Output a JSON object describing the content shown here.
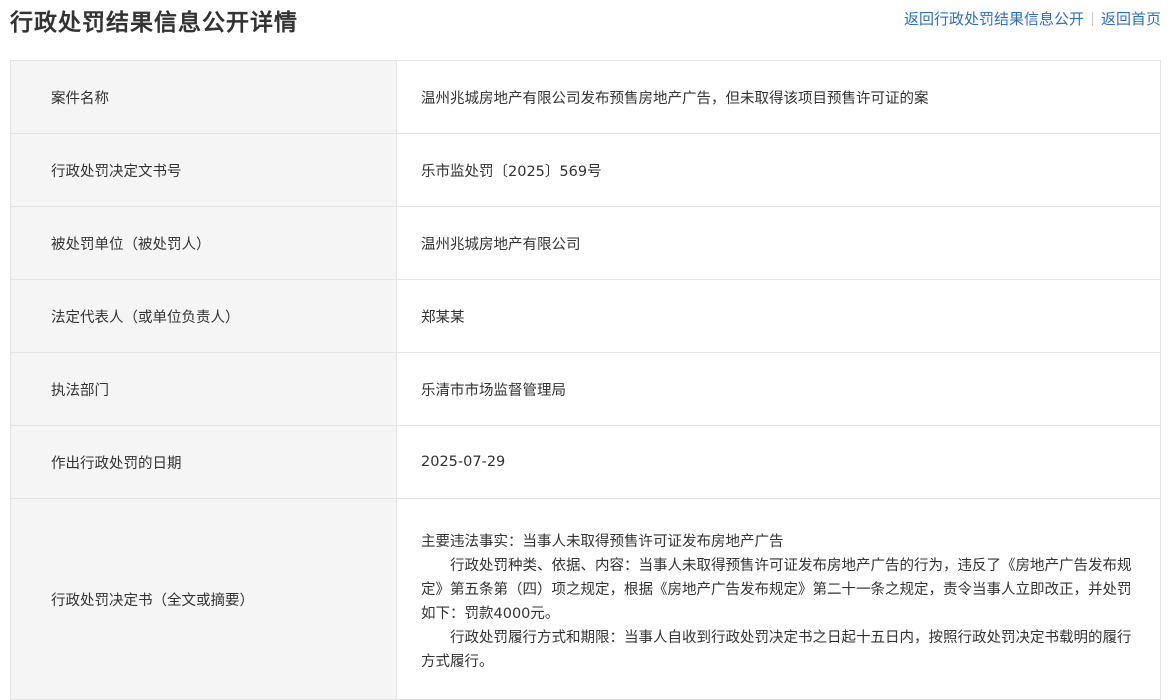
{
  "header": {
    "title": "行政处罚结果信息公开详情",
    "links": {
      "back_list": "返回行政处罚结果信息公开",
      "back_home": "返回首页"
    }
  },
  "rows": [
    {
      "label": "案件名称",
      "value": "温州兆城房地产有限公司发布预售房地产广告，但未取得该项目预售许可证的案"
    },
    {
      "label": "行政处罚决定文书号",
      "value": "乐市监处罚〔2025〕569号"
    },
    {
      "label": "被处罚单位（被处罚人）",
      "value": "温州兆城房地产有限公司"
    },
    {
      "label": "法定代表人（或单位负责人）",
      "value": "郑某某"
    },
    {
      "label": "执法部门",
      "value": "乐清市市场监督管理局"
    },
    {
      "label": "作出行政处罚的日期",
      "value": "2025-07-29"
    }
  ],
  "decision": {
    "label": "行政处罚决定书（全文或摘要）",
    "paragraphs": [
      "主要违法事实：当事人未取得预售许可证发布房地产广告",
      "行政处罚种类、依据、内容：当事人未取得预售许可证发布房地产广告的行为，违反了《房地产广告发布规定》第五条第（四）项之规定，根据《房地产广告发布规定》第二十一条之规定，责令当事人立即改正，并处罚如下：罚款4000元。",
      "行政处罚履行方式和期限：当事人自收到行政处罚决定书之日起十五日内，按照行政处罚决定书载明的履行方式履行。"
    ]
  },
  "colors": {
    "link": "#2f6fc1",
    "label_bg": "#f5f5f5",
    "border": "#e4e4e4",
    "text": "#333333"
  }
}
